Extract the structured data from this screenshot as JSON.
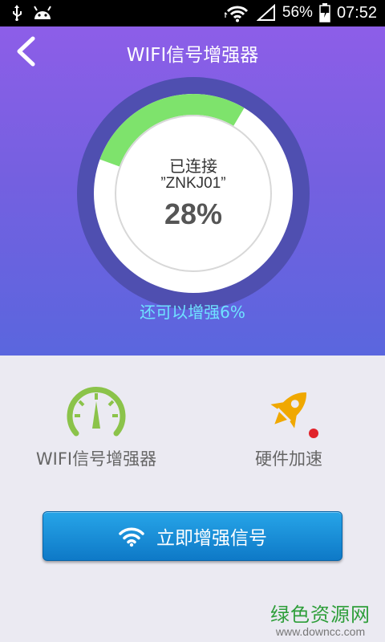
{
  "status_bar": {
    "battery_percent": "56%",
    "time": "07:52",
    "icons": [
      "usb-icon",
      "android-icon",
      "wifi-icon",
      "signal-icon",
      "battery-charging-icon"
    ]
  },
  "header": {
    "title": "WIFI信号增强器",
    "back_icon": "chevron-left-icon"
  },
  "gauge": {
    "status": "已连接",
    "network_name": "”ZNKJ01”",
    "percent_label": "28%",
    "percent_value": 28
  },
  "boost_hint": "还可以增强6%",
  "features": {
    "wifi": {
      "label": "WIFI信号增强器",
      "icon": "speedometer-icon"
    },
    "hardware": {
      "label": "硬件加速",
      "icon": "rocket-icon",
      "badge": "red-dot"
    }
  },
  "boost_button": {
    "label": "立即增强信号",
    "icon": "wifi-icon"
  },
  "watermark": {
    "title": "绿色资源网",
    "url": "www.downcc.com"
  },
  "colors": {
    "hero_top": "#8d5ee8",
    "hero_bottom": "#5a66de",
    "gauge_ring": "#4f4fb0",
    "progress": "#7ee36c",
    "hint": "#6fe3ff",
    "button": "#1a8dd8",
    "badge": "#e1232b"
  }
}
